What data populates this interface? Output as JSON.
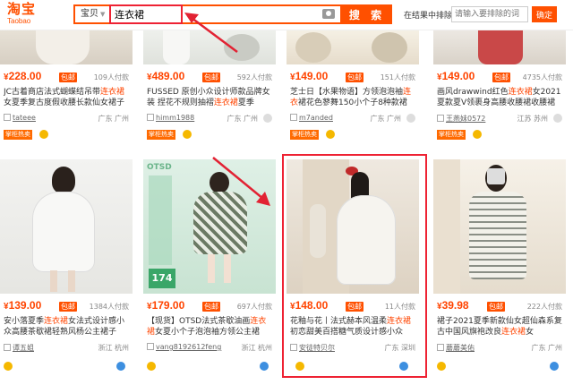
{
  "header": {
    "logo_main": "淘宝",
    "logo_sub": "Taobao",
    "search_category": "宝贝",
    "search_value": "连衣裙",
    "search_button": "搜 索",
    "sort_label": "在结果中排除",
    "sort_placeholder": "请输入要排除的词",
    "sort_button": "确定"
  },
  "cards": [
    {
      "price": "228.00",
      "post": "包邮",
      "sales": "109人付款",
      "title_pre": "JC古着商店法式蝴蝶结吊带",
      "title_hl": "连衣裙",
      "title_post": "女夏季复古度假收腰长款仙女裙子",
      "shop": "tateee",
      "loc": "广东 广州",
      "tag": "掌柜热卖"
    },
    {
      "price": "489.00",
      "post": "包邮",
      "sales": "592人付款",
      "title_pre": "FUSSED 原创小众设计师款品牌女装 捏花不规则抽褶",
      "title_hl": "连衣裙",
      "title_post": "夏季",
      "shop": "himm1988",
      "loc": "广东 广州",
      "tag": "掌柜热卖"
    },
    {
      "price": "149.00",
      "post": "包邮",
      "sales": "151人付款",
      "title_pre": "芝士日【水果物语】方领泡泡袖",
      "title_hl": "连衣",
      "title_post": "裙花色蓼舞150小个子8种款裙",
      "shop": "m7anded",
      "loc": "广东 广州",
      "tag": "掌柜热卖"
    },
    {
      "price": "149.00",
      "post": "包邮",
      "sales": "4735人付款",
      "title_pre": "画风drawwind红色",
      "title_hl": "连衣裙",
      "title_post": "女2021夏款夏V领裹身高腰收腰裙收腰裙",
      "shop": "王燕妹0572",
      "loc": "江苏 苏州",
      "tag": "掌柜热卖"
    },
    {
      "price": "139.00",
      "post": "包邮",
      "sales": "1384人付款",
      "title_pre": "安小落夏季",
      "title_hl": "连衣裙",
      "title_post": "女法式设计感小众高腰茶歇裙轻熟风杨公主裙子",
      "shop": "谭五姐",
      "loc": "浙江 杭州",
      "tag": ""
    },
    {
      "price": "179.00",
      "post": "包邮",
      "sales": "697人付款",
      "title_pre": "【现货】OTSD法式茶歇油画",
      "title_hl": "连衣裙",
      "title_post": "女夏小个子泡泡袖方领公主裙",
      "shop": "vang8192612feng",
      "loc": "浙江 杭州",
      "tag": ""
    },
    {
      "price": "148.00",
      "post": "包邮",
      "sales": "11人付款",
      "title_pre": "花釉与花丨法式赫本风温柔",
      "title_hl": "连衣裙",
      "title_post": "初恋甜美百搭糖气质设计感小众",
      "shop": "安徒特贝尔",
      "loc": "广东 深圳",
      "tag": ""
    },
    {
      "price": "39.98",
      "post": "包邮",
      "sales": "222人付款",
      "title_pre": "裙子2021夏季新款仙女超仙森系复古中国风旗袍改良",
      "title_hl": "连衣裙",
      "title_post": "女",
      "shop": "蘑蘑美佑",
      "loc": "广东 广州",
      "tag": ""
    }
  ],
  "image_text": {
    "otsd": "OTSD",
    "otsd_price": "174"
  },
  "colors": {
    "accent": "#ff5000",
    "price": "#ff4400",
    "annotation": "#e22233"
  }
}
